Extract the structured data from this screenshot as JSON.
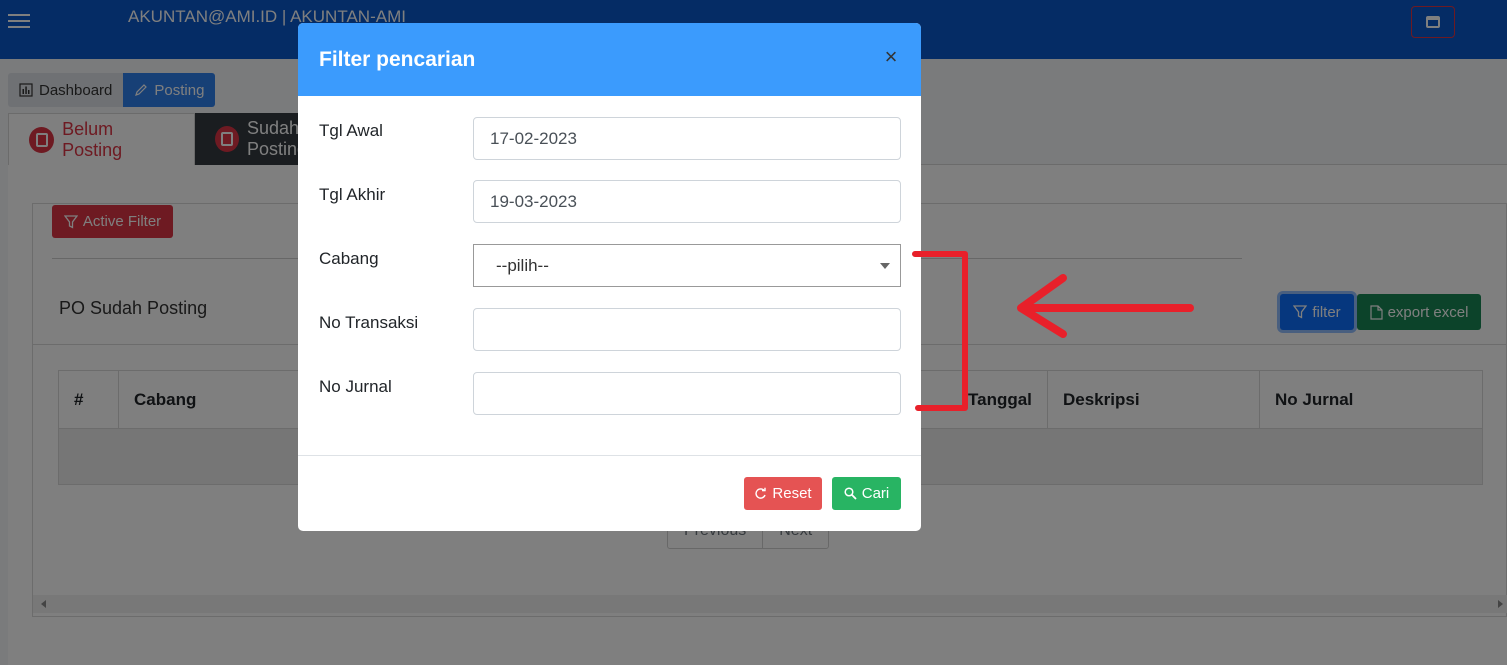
{
  "topbar": {
    "user": "AKUNTAN@AMI.ID | AKUNTAN-AMI"
  },
  "breadcrumb": {
    "dashboard": "Dashboard",
    "posting": "Posting"
  },
  "tabs": {
    "belum": "Belum Posting",
    "sudah": "Sudah Posting"
  },
  "card": {
    "active_filter": "Active Filter",
    "title": "PO Sudah Posting",
    "filter_button": "filter",
    "export_button": "export excel"
  },
  "table": {
    "columns": [
      "#",
      "Cabang",
      "Tanggal",
      "Deskripsi",
      "No Jurnal"
    ]
  },
  "pager": {
    "previous": "Previous",
    "next": "Next"
  },
  "modal": {
    "title": "Filter pencarian",
    "close": "×",
    "fields": {
      "tgl_awal": {
        "label": "Tgl Awal",
        "value": "17-02-2023"
      },
      "tgl_akhir": {
        "label": "Tgl Akhir",
        "value": "19-03-2023"
      },
      "cabang": {
        "label": "Cabang",
        "value": "--pilih--"
      },
      "no_transaksi": {
        "label": "No Transaksi",
        "value": ""
      },
      "no_jurnal": {
        "label": "No Jurnal",
        "value": ""
      }
    },
    "reset": "Reset",
    "cari": "Cari"
  },
  "colors": {
    "topbar": "#0a58ca",
    "modal_header": "#3b9bfd",
    "danger": "#dc3545",
    "success": "#28b463",
    "primary": "#0d6efd",
    "annotation": "#e8202a"
  },
  "icons": {
    "menu": "hamburger-icon",
    "window": "window-icon",
    "dashboard": "bar-chart-icon",
    "posting": "pencil-icon",
    "belum": "document-icon",
    "sudah": "calendar-check-icon",
    "filter": "funnel-icon",
    "export": "file-icon",
    "reset": "refresh-icon",
    "cari": "search-icon"
  }
}
